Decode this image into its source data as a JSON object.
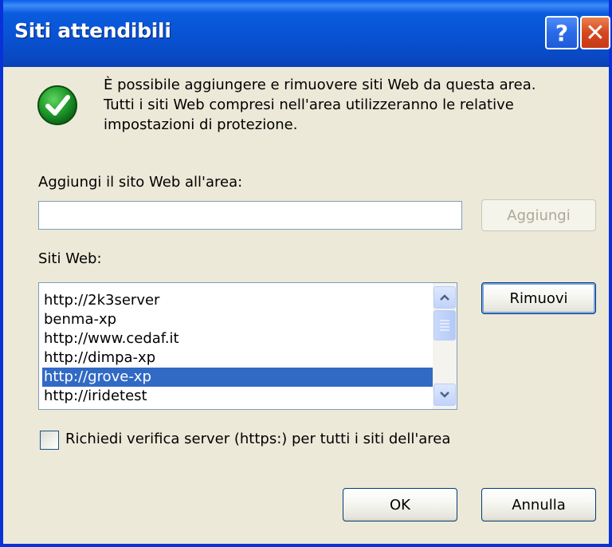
{
  "window": {
    "title": "Siti attendibili",
    "help_label": "?",
    "close_label": "✕"
  },
  "info": {
    "icon": "check-icon",
    "text_line1": "È possibile aggiungere e rimuovere siti Web da questa area.",
    "text_line2": "Tutti i siti Web compresi nell'area utilizzeranno le relative",
    "text_line3": "impostazioni di protezione."
  },
  "add": {
    "label": "Aggiungi il sito Web all'area:",
    "input_value": "",
    "button_label": "Aggiungi"
  },
  "sites": {
    "label": "Siti Web:",
    "items": [
      "http://2k3server",
      "benma-xp",
      "http://www.cedaf.it",
      "http://dimpa-xp",
      "http://grove-xp",
      "http://iridetest"
    ],
    "selected": "http://grove-xp",
    "remove_label": "Rimuovi"
  },
  "https_check": {
    "label": "Richiedi verifica server (https:) per tutti i siti dell'area",
    "checked": false
  },
  "footer": {
    "ok_label": "OK",
    "cancel_label": "Annulla"
  },
  "colors": {
    "titlebar": "#0a52d6",
    "selection": "#316ac5",
    "dialog_bg": "#ece9d8"
  }
}
